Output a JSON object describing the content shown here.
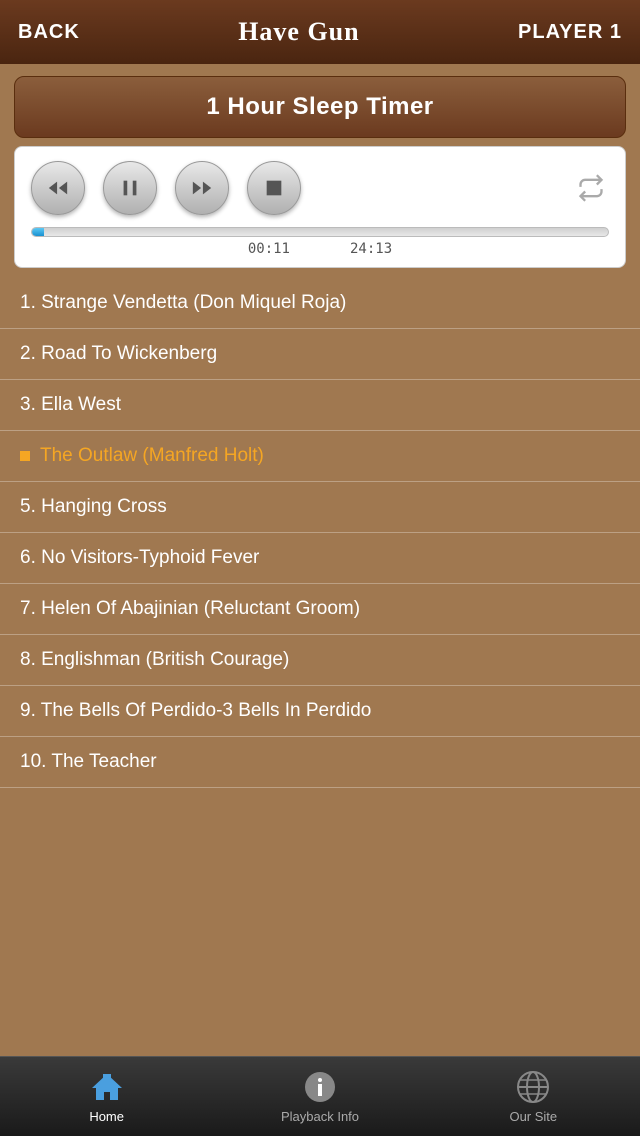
{
  "header": {
    "back_label": "BACK",
    "title": "Have Gun",
    "player_label": "PLAYER 1"
  },
  "sleep_timer": {
    "label": "1 Hour Sleep Timer"
  },
  "player": {
    "current_time": "00:11",
    "total_time": "24:13",
    "progress_percent": 2
  },
  "tracks": [
    {
      "id": 1,
      "label": "1. Strange Vendetta (Don Miquel Roja)",
      "active": false
    },
    {
      "id": 2,
      "label": "2. Road To Wickenberg",
      "active": false
    },
    {
      "id": 3,
      "label": "3. Ella West",
      "active": false
    },
    {
      "id": 4,
      "label": "The Outlaw (Manfred Holt)",
      "active": true
    },
    {
      "id": 5,
      "label": "5. Hanging Cross",
      "active": false
    },
    {
      "id": 6,
      "label": "6. No Visitors-Typhoid Fever",
      "active": false
    },
    {
      "id": 7,
      "label": "7. Helen Of Abajinian (Reluctant Groom)",
      "active": false
    },
    {
      "id": 8,
      "label": "8. Englishman (British Courage)",
      "active": false
    },
    {
      "id": 9,
      "label": "9. The Bells Of Perdido-3 Bells In Perdido",
      "active": false
    },
    {
      "id": 10,
      "label": "10. The Teacher",
      "active": false
    }
  ],
  "tabs": [
    {
      "id": "home",
      "label": "Home",
      "active": true
    },
    {
      "id": "playback",
      "label": "Playback Info",
      "active": false
    },
    {
      "id": "site",
      "label": "Our Site",
      "active": false
    }
  ]
}
